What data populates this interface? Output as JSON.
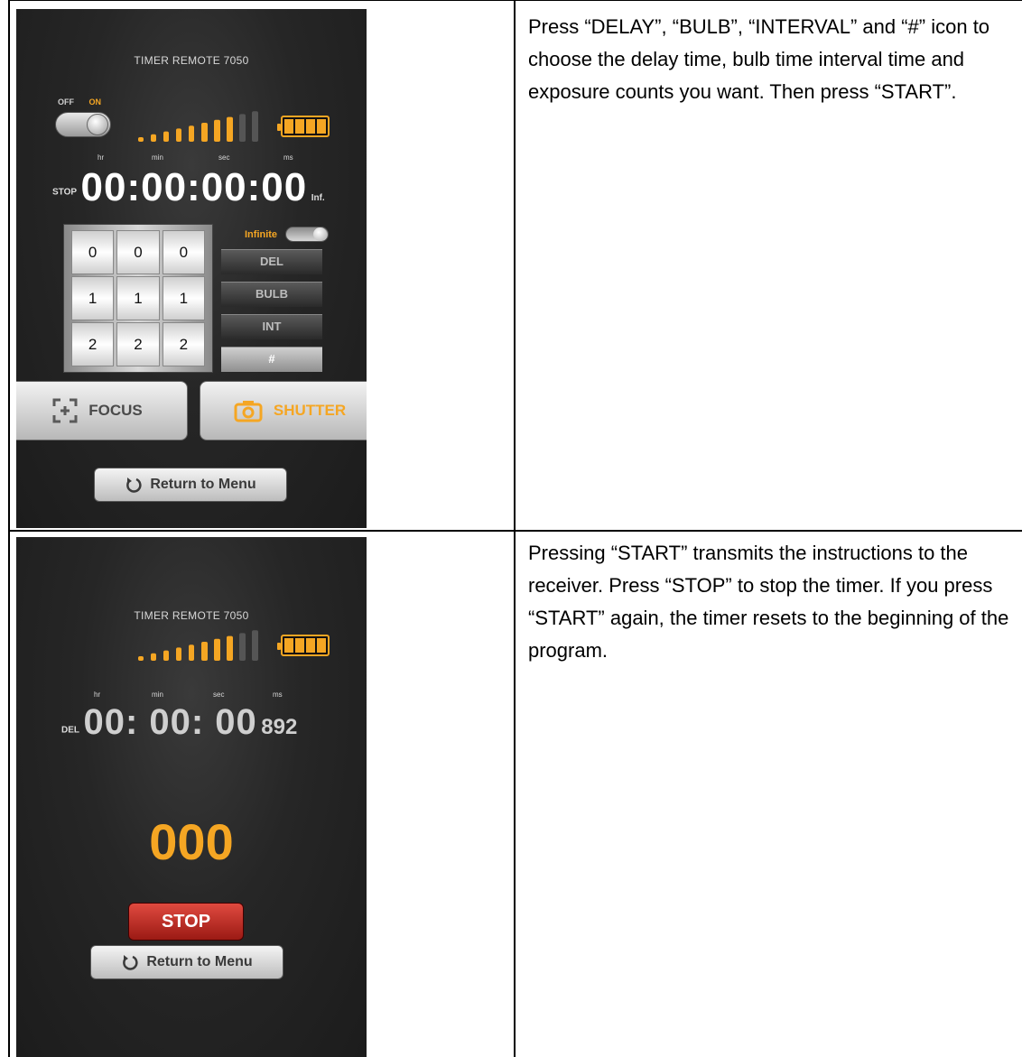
{
  "colors": {
    "accent": "#f5a623",
    "stop_red": "#c0392b",
    "screen_bg": "#262626"
  },
  "rows": [
    {
      "description": "Press “DELAY”, “BULB”, “INTERVAL” and “#” icon to choose the delay time, bulb time interval time and exposure counts you want. Then press “START”.",
      "screen": {
        "app_title": "TIMER REMOTE 7050",
        "power_off_label": "OFF",
        "power_on_label": "ON",
        "signal_bars": 10,
        "signal_bars_lit": 8,
        "battery_cells": 4,
        "unit_labels": [
          "hr",
          "min",
          "sec",
          "ms"
        ],
        "mode_label": "STOP",
        "time": "00:00:00:00",
        "inf_label": "Inf.",
        "infinite_label": "Infinite",
        "wheels": [
          [
            "0",
            "1",
            "2"
          ],
          [
            "0",
            "1",
            "2"
          ],
          [
            "0",
            "1",
            "2"
          ]
        ],
        "buttons": {
          "del": "DEL",
          "bulb": "BULB",
          "int": "INT",
          "count": "#"
        },
        "focus_label": "FOCUS",
        "shutter_label": "SHUTTER",
        "menu_label": "Return to Menu"
      }
    },
    {
      "description": "Pressing “START” transmits the instructions to the receiver. Press “STOP” to stop the timer. If you press “START” again, the timer resets to the beginning of the program.",
      "screen": {
        "app_title": "TIMER REMOTE 7050",
        "signal_bars": 10,
        "signal_bars_lit": 8,
        "battery_cells": 4,
        "unit_labels": [
          "hr",
          "min",
          "sec",
          "ms"
        ],
        "mode_label": "DEL",
        "time": "00: 00: 00",
        "ms_value": "892",
        "counter": "000",
        "stop_label": "STOP",
        "menu_label": "Return to Menu"
      }
    }
  ]
}
